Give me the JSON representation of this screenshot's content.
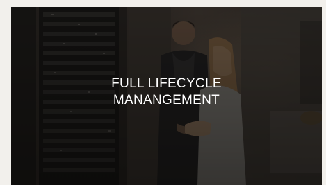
{
  "card": {
    "title_lines": [
      "FULL LIFECYCLE",
      "MANANGEMENT"
    ],
    "image": "office-server-room-meeting-photo"
  },
  "colors": {
    "page_background": "#f2f0ec",
    "overlay": "#100d0a",
    "title": "#ffffff"
  }
}
